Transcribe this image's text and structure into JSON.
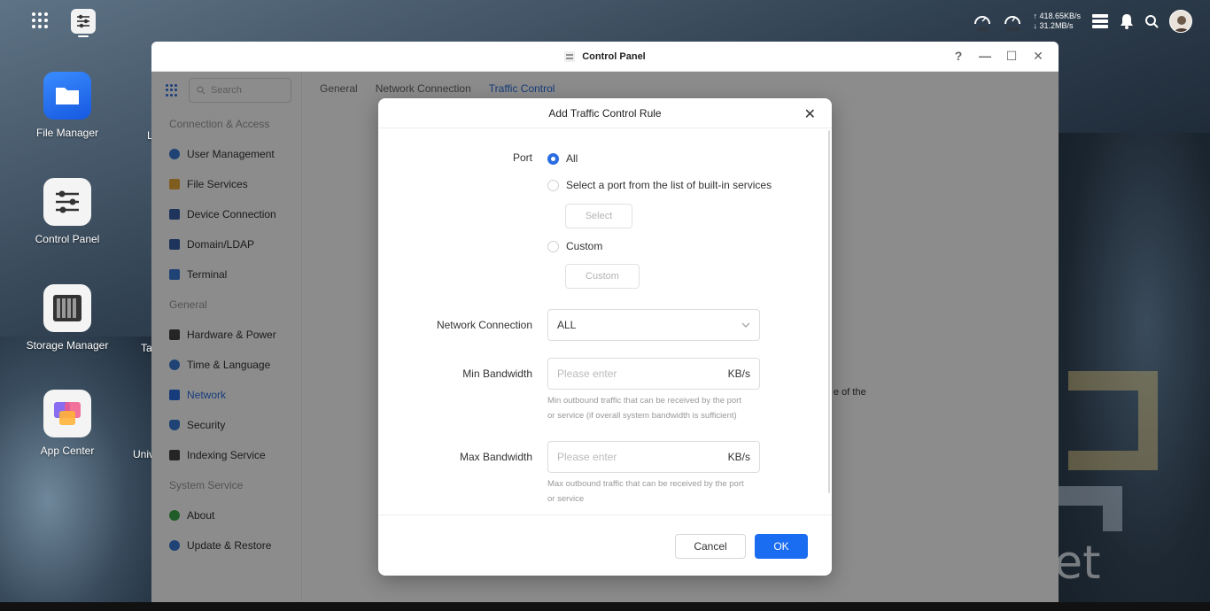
{
  "topbar": {
    "cpu_label": "CPU",
    "ram_label": "RAM",
    "upload_speed": "↑ 418.65KB/s",
    "download_speed": "↓ 31.2MB/s"
  },
  "desktop": {
    "icons": [
      {
        "label": "File Manager"
      },
      {
        "label": "Control Panel"
      },
      {
        "label": "Storage Manager"
      },
      {
        "label": "App Center"
      }
    ],
    "partial_labels": [
      "L",
      "Ta",
      "Univ"
    ]
  },
  "window": {
    "title": "Control Panel",
    "search_placeholder": "Search",
    "help": "?",
    "minimize": "—",
    "maximize": "☐",
    "close": "✕",
    "tabs": [
      "General",
      "Network Connection",
      "Traffic Control"
    ],
    "sidebar": {
      "section_connection": "Connection & Access",
      "connection_items": [
        "User Management",
        "File Services",
        "Device Connection",
        "Domain/LDAP",
        "Terminal"
      ],
      "section_general": "General",
      "general_items": [
        "Hardware & Power",
        "Time & Language",
        "Network",
        "Security",
        "Indexing Service"
      ],
      "section_system": "System Service",
      "system_items": [
        "About",
        "Update & Restore"
      ]
    },
    "content_fragment": "e of the"
  },
  "dialog": {
    "title": "Add Traffic Control Rule",
    "close": "✕",
    "port_label": "Port",
    "port_options": [
      "All",
      "Select a port from the list of built-in services",
      "Custom"
    ],
    "select_button": "Select",
    "custom_button": "Custom",
    "network_label": "Network Connection",
    "network_value": "ALL",
    "min_label": "Min Bandwidth",
    "min_placeholder": "Please enter",
    "min_unit": "KB/s",
    "min_hint_1": "Min outbound traffic that can be received by the port",
    "min_hint_2": "or service (if overall system bandwidth is sufficient)",
    "max_label": "Max Bandwidth",
    "max_placeholder": "Please enter",
    "max_unit": "KB/s",
    "max_hint_1": "Max outbound traffic that can be received by the port",
    "max_hint_2": "or service",
    "cancel": "Cancel",
    "ok": "OK"
  },
  "watermark": "Pocket",
  "colors": {
    "accent": "#1a6cf0",
    "link": "#2a6de0"
  }
}
